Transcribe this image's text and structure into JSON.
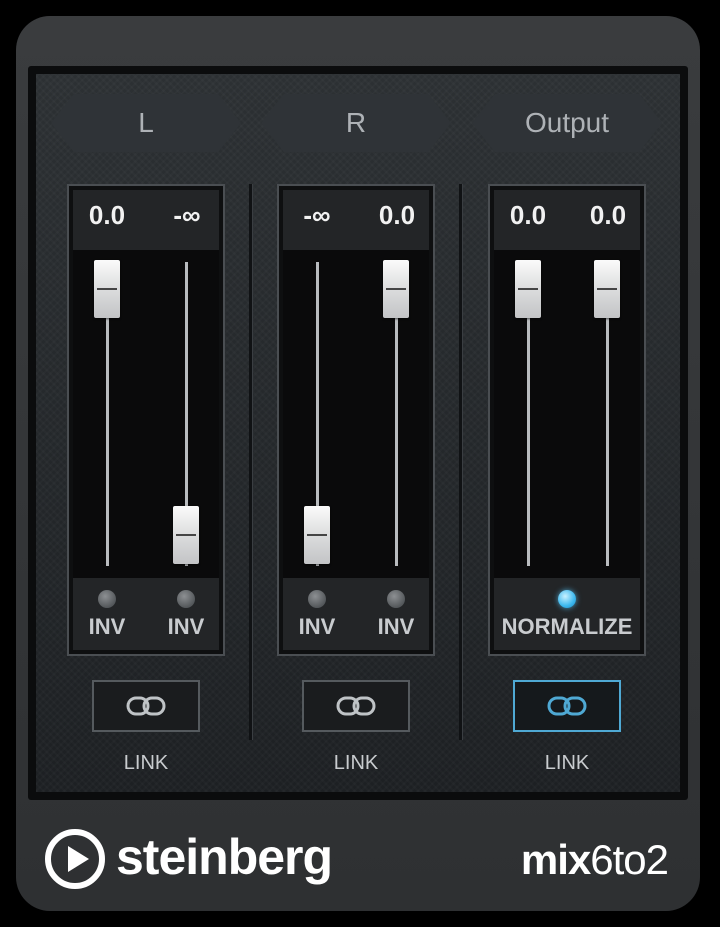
{
  "channels": [
    {
      "header": "L",
      "values": [
        "0.0",
        "-∞"
      ],
      "faders": [
        {
          "level": 1.0
        },
        {
          "level": 0.0
        }
      ],
      "switches": [
        {
          "label": "INV",
          "on": false
        },
        {
          "label": "INV",
          "on": false
        }
      ],
      "link_label": "LINK",
      "link_active": false
    },
    {
      "header": "R",
      "values": [
        "-∞",
        "0.0"
      ],
      "faders": [
        {
          "level": 0.0
        },
        {
          "level": 1.0
        }
      ],
      "switches": [
        {
          "label": "INV",
          "on": false
        },
        {
          "label": "INV",
          "on": false
        }
      ],
      "link_label": "LINK",
      "link_active": false
    },
    {
      "header": "Output",
      "values": [
        "0.0",
        "0.0"
      ],
      "faders": [
        {
          "level": 1.0
        },
        {
          "level": 1.0
        }
      ],
      "switches": [
        {
          "label": "NORMALIZE",
          "on": true
        }
      ],
      "link_label": "LINK",
      "link_active": true
    }
  ],
  "brand": "steinberg",
  "product": {
    "bold": "mix",
    "light": "6to2"
  },
  "colors": {
    "accent": "#4fa9d4",
    "led_on": "#3cb8ee",
    "text": "#c9cccf"
  },
  "icons": {
    "link": "chain-link-icon",
    "logo": "play-circle-icon"
  }
}
